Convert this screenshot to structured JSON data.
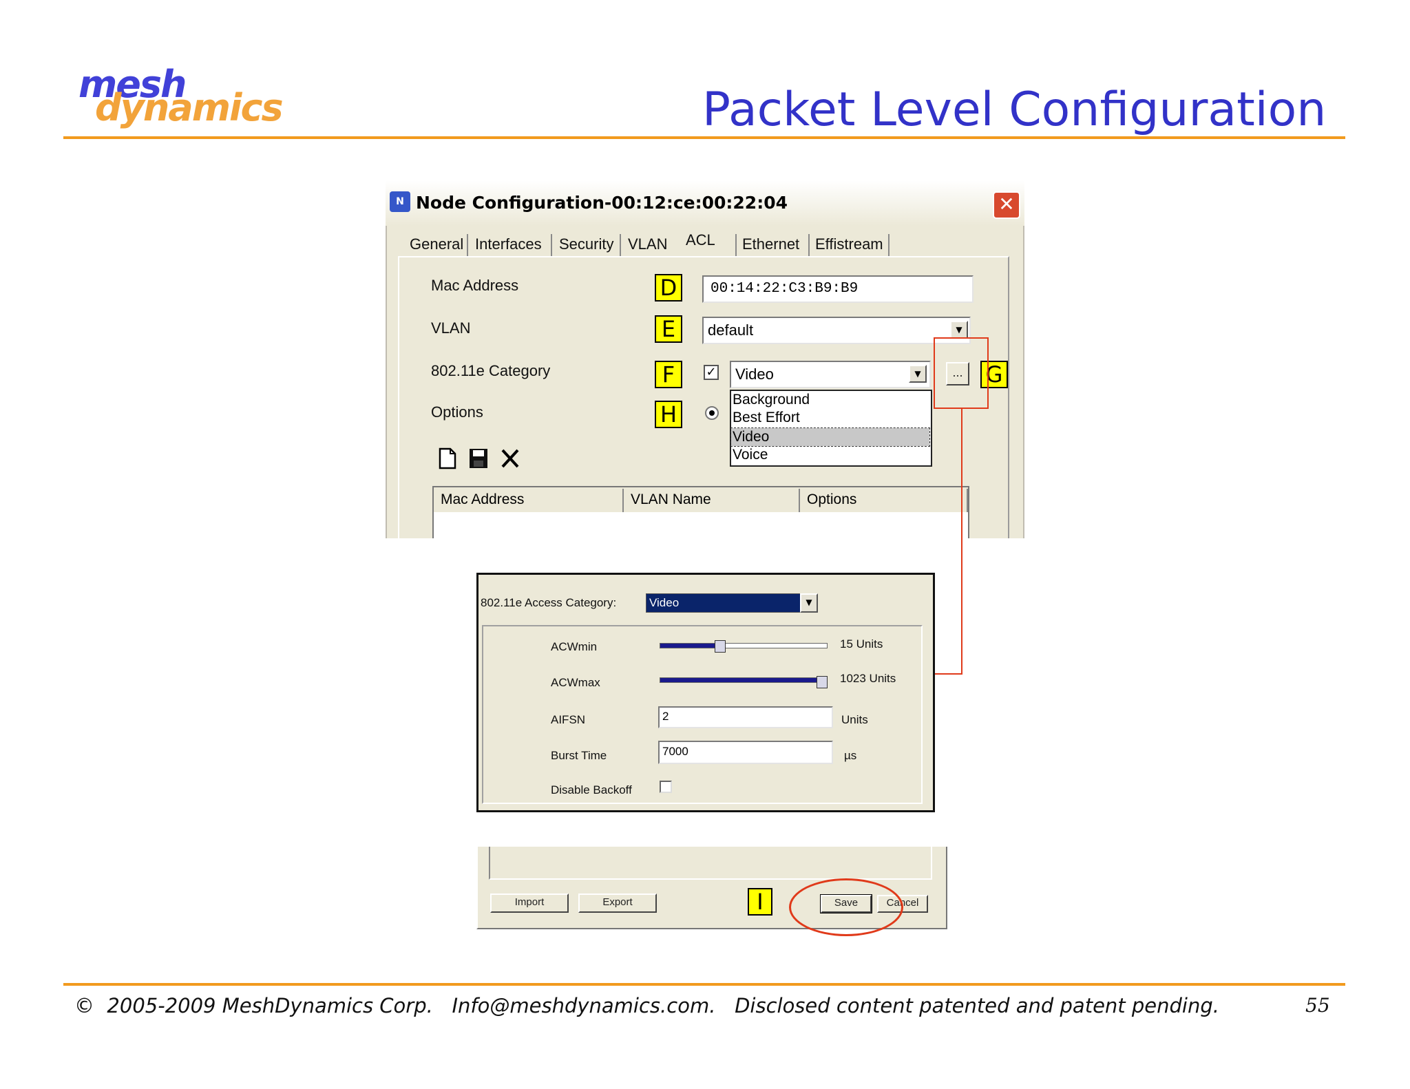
{
  "slide": {
    "logo_top": "mesh",
    "logo_bottom": "dynamics",
    "title": "Packet Level Configuration",
    "footer": "©  2005-2009 MeshDynamics Corp.   Info@meshdynamics.com.   Disclosed content patented and patent pending.",
    "page_number": "55"
  },
  "window": {
    "title": "Node Configuration-00:12:ce:00:22:04",
    "tabs": [
      {
        "label": "General"
      },
      {
        "label": "Interfaces"
      },
      {
        "label": "Security"
      },
      {
        "label": "VLAN"
      },
      {
        "label": "ACL"
      },
      {
        "label": "Ethernet"
      },
      {
        "label": "Effistream"
      }
    ],
    "active_tab": "ACL",
    "form": {
      "mac_label": "Mac Address",
      "mac_value": "00:14:22:C3:B9:B9",
      "vlan_label": "VLAN",
      "vlan_value": "default",
      "category_label": "802.11e Category",
      "category_value": "Video",
      "category_checked": true,
      "category_options": [
        "Background",
        "Best Effort",
        "Video",
        "Voice"
      ],
      "options_label": "Options",
      "more_button": "..."
    },
    "table_headers": [
      "Mac Address",
      "VLAN Name",
      "Options"
    ]
  },
  "markers": {
    "D": "D",
    "E": "E",
    "F": "F",
    "G": "G",
    "H": "H",
    "I": "I"
  },
  "access_category_panel": {
    "category_label": "802.11e Access Category:",
    "category_value": "Video",
    "acwmin_label": "ACWmin",
    "acwmin_value": "15 Units",
    "acwmin_fraction": 0.35,
    "acwmax_label": "ACWmax",
    "acwmax_value": "1023 Units",
    "acwmax_fraction": 1.0,
    "aifsn_label": "AIFSN",
    "aifsn_value": "2",
    "aifsn_unit": "Units",
    "burst_label": "Burst Time",
    "burst_value": "7000",
    "burst_unit": "µs",
    "disable_backoff_label": "Disable Backoff",
    "disable_backoff_checked": false
  },
  "bottom_bar": {
    "import": "Import",
    "export": "Export",
    "save": "Save",
    "cancel": "Cancel"
  },
  "colors": {
    "accent_orange": "#f29a1e",
    "title_blue": "#3232c8",
    "annotation_red": "#e03a1a",
    "marker_yellow": "#ffff00",
    "selection_navy": "#0a246a"
  }
}
